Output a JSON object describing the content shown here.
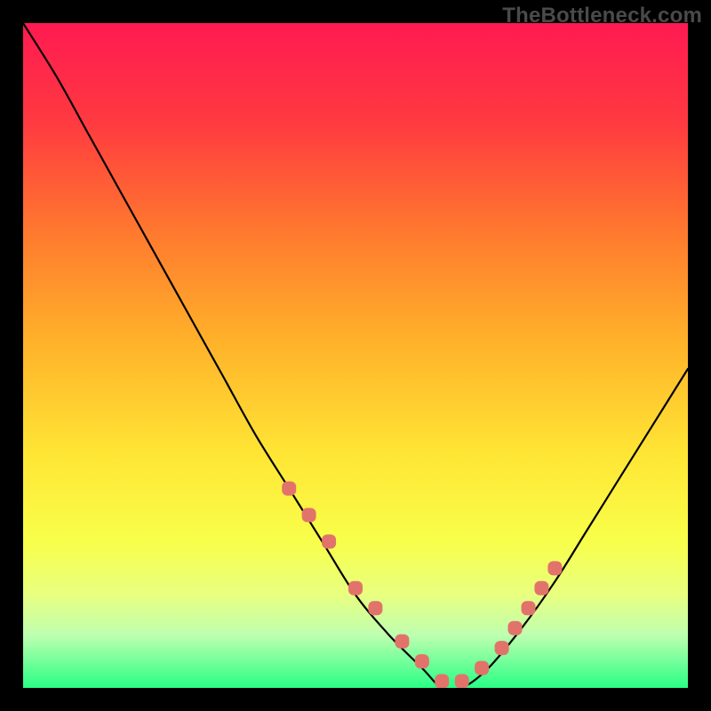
{
  "brand": "TheBottleneck.com",
  "chart_data": {
    "type": "line",
    "title": "",
    "xlabel": "",
    "ylabel": "",
    "xlim": [
      0,
      100
    ],
    "ylim": [
      0,
      100
    ],
    "series": [
      {
        "name": "bottleneck-curve",
        "x": [
          0,
          5,
          10,
          15,
          20,
          25,
          30,
          35,
          40,
          45,
          50,
          55,
          60,
          63,
          66,
          70,
          75,
          80,
          85,
          90,
          95,
          100
        ],
        "values": [
          100,
          92,
          83,
          74,
          65,
          56,
          47,
          38,
          30,
          22,
          14,
          8,
          3,
          0,
          0,
          3,
          9,
          16,
          24,
          32,
          40,
          48
        ]
      }
    ],
    "markers": {
      "name": "highlighted-points",
      "color": "#e2736b",
      "x": [
        40,
        43,
        46,
        50,
        53,
        57,
        60,
        63,
        66,
        69,
        72,
        74,
        76,
        78,
        80
      ],
      "values": [
        30,
        26,
        22,
        15,
        12,
        7,
        4,
        1,
        1,
        3,
        6,
        9,
        12,
        15,
        18
      ]
    }
  }
}
